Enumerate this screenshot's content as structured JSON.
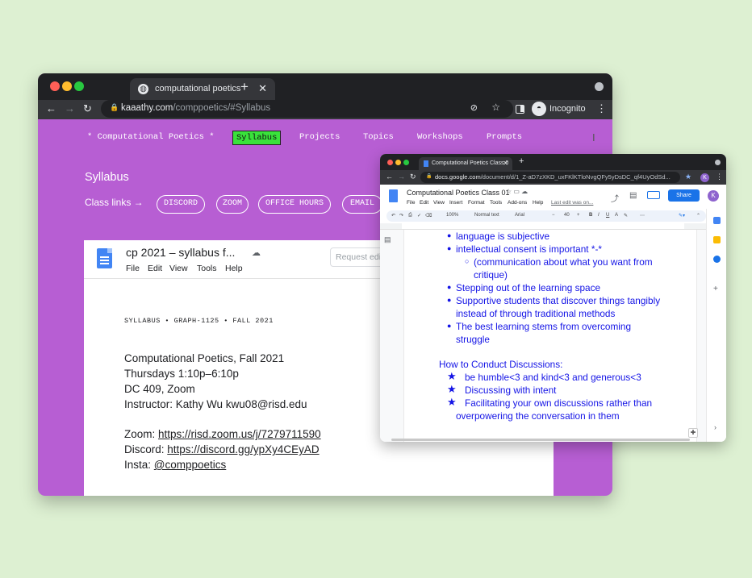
{
  "main_window": {
    "tab_title": "computational poetics",
    "url_host": "kaaathy.com",
    "url_path": "/comppoetics/#Syllabus",
    "incognito_label": "Incognito"
  },
  "site": {
    "brand": "* Computational Poetics *",
    "nav": [
      "Syllabus",
      "Projects",
      "Topics",
      "Workshops",
      "Prompts"
    ],
    "active_nav": "Syllabus",
    "accent_bg": "#b75ed3",
    "active_color": "#39e23b",
    "section_title": "Syllabus",
    "class_links_label": "Class links →",
    "class_links": [
      "DISCORD",
      "ZOOM",
      "OFFICE HOURS",
      "EMAIL"
    ]
  },
  "embedded_doc": {
    "title": "cp 2021 – syllabus f...",
    "menu": [
      "File",
      "Edit",
      "View",
      "Tools",
      "Help"
    ],
    "request_edit": "Request edit",
    "heading": "SYLLABUS  •  GRAPH-1125  •  FALL 2021",
    "lines": [
      "Computational Poetics, Fall 2021",
      "Thursdays 1:10p–6:10p",
      "DC 409, Zoom",
      "Instructor: Kathy Wu kwu08@risd.edu"
    ],
    "zoom_label": "Zoom: ",
    "zoom_link": "https://risd.zoom.us/j/7279711590",
    "discord_label": "Discord: ",
    "discord_link": "https://discord.gg/ypXy4CEyAD",
    "insta_label": "Insta: ",
    "insta_link": "@comppoetics"
  },
  "docs_window": {
    "tab_title": "Computational Poetics Class 0",
    "url_host": "docs.google.com",
    "url_path": "/document/d/1_Z-aD7zXKD_uxFKlKTloNvgQFy5yDsDC_qf4UyOdSd...",
    "avatar_letter": "K",
    "doc_title": "Computational Poetics Class 01",
    "menu": [
      "File",
      "Edit",
      "View",
      "Insert",
      "Format",
      "Tools",
      "Add-ons",
      "Help"
    ],
    "last_edit": "Last edit was on...",
    "share_label": "Share",
    "toolbar": {
      "zoom": "100%",
      "style": "Normal text",
      "font": "Arial",
      "size": "40"
    },
    "content": {
      "bullets": [
        "language is subjective",
        "intellectual consent is important *-*"
      ],
      "sub_bullet": [
        "(communication about what you want from",
        "critique)"
      ],
      "bullets2": [
        [
          "Stepping out of the learning space"
        ],
        [
          "Supportive students that discover things tangibly",
          "instead of through traditional methods"
        ],
        [
          "The best learning stems from overcoming",
          "struggle"
        ]
      ],
      "heading": "How to Conduct Discussions:",
      "stars": [
        [
          "be humble<3 and kind<3 and generous<3"
        ],
        [
          "Discussing with intent"
        ],
        [
          "Facilitating your own discussions rather than",
          "overpowering the conversation in them"
        ]
      ],
      "text_color": "#1414e6"
    }
  }
}
